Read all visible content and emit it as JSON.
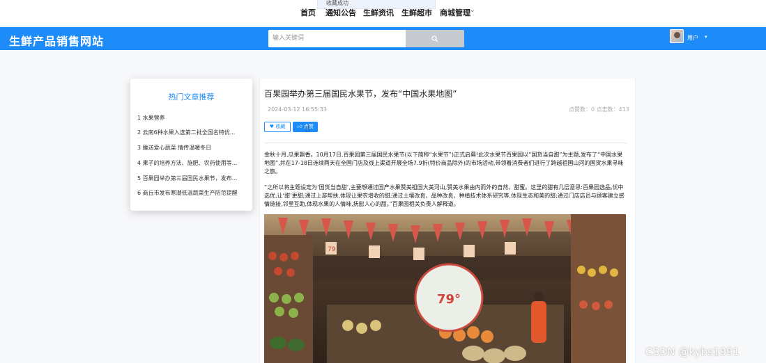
{
  "topnav": {
    "toast": "收藏成功",
    "items": [
      "首页",
      "通知公告",
      "生鲜资讯",
      "生鲜超市",
      "商城管理"
    ]
  },
  "header": {
    "site_title": "生鲜产品销售网站",
    "search_placeholder": "输入关键词",
    "user_label": "用户"
  },
  "sidebar": {
    "title": "热门文章推荐",
    "items": [
      "1  水果营养",
      "2  云南6种水果入选第二批全国名特优...",
      "3  雕送爱心蔬菜 情传温暖冬日",
      "4  果子的培养方法、施肥、农药使用等...",
      "5  百果园举办第三届国民水果节，发布...",
      "6  商丘市发布寒潮低温蔬菜生产防范提醒"
    ]
  },
  "article": {
    "title": "百果园举办第三届国民水果节，发布“中国水果地图”",
    "date": "2024-03-12 16:55:33",
    "stats": "点赞数：0    点击数：413",
    "fav_label": "收藏",
    "like_label": "点赞",
    "paragraph1": "金秋十月,瓜果飘香。10月17日,百果园第三届国民水果节(以下简称“水果节”)正式启幕!此次水果节百果园以“国货当自甜”为主题,发布了“中国水果地图”,并在17-18日连续两天在全国门店及线上渠道开展全场7.9折(特价商品除外)的市场活动,带领着消费者们进行了跨越祖国山河的国货水果寻味之旅。",
    "paragraph2": "“之所以将主题设定为‘国货当自甜’,主要想通过国产水果赞美祖国大美河山,赞美水果由内而外的自然、甜蜜。这里的甜有几层意思:百果园选品,优中选优,让‘甜’更甜;通过上游帮扶,体现让果农增收的甜;通过土壤改良、品种改良、种植技术体系研究等,体现生态和美的甜;通过门店店员与顾客建立感情链接,邻里互助,体现水果的人情味,抚慰人心的甜。”百果园相关负责人解释道。"
  },
  "photo": {
    "sign_text": "79",
    "display_text": "79°"
  },
  "watermark": "CSDN @kybs1991"
}
